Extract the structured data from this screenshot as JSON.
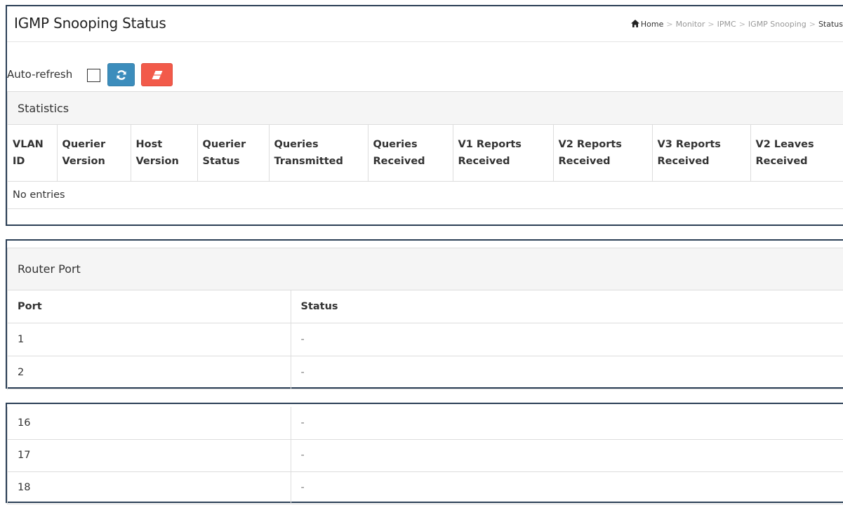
{
  "header": {
    "title": "IGMP Snooping Status",
    "breadcrumb": {
      "home": "Home",
      "items": [
        "Monitor",
        "IPMC",
        "IGMP Snooping"
      ],
      "current": "Status",
      "separator": ">"
    }
  },
  "toolbar": {
    "auto_refresh_label": "Auto-refresh",
    "auto_refresh_checked": false,
    "refresh_icon": "refresh-icon",
    "clear_icon": "eraser-icon",
    "refresh_color": "#3c8dbc",
    "clear_color": "#f25a4a"
  },
  "statistics": {
    "heading": "Statistics",
    "columns": [
      [
        "VLAN",
        "ID"
      ],
      [
        "Querier",
        "Version"
      ],
      [
        "Host",
        "Version"
      ],
      [
        "Querier",
        "Status"
      ],
      [
        "Queries",
        "Transmitted"
      ],
      [
        "Queries",
        "Received"
      ],
      [
        "V1 Reports",
        "Received"
      ],
      [
        "V2 Reports",
        "Received"
      ],
      [
        "V3 Reports",
        "Received"
      ],
      [
        "V2 Leaves",
        "Received"
      ]
    ],
    "empty_text": "No entries"
  },
  "router_port": {
    "heading": "Router Port",
    "col_port": "Port",
    "col_status": "Status",
    "rows": [
      {
        "port": "1",
        "status": "-"
      },
      {
        "port": "2",
        "status": "-"
      }
    ]
  },
  "router_port_continued": {
    "rows": [
      {
        "port": "16",
        "status": "-"
      },
      {
        "port": "17",
        "status": "-"
      },
      {
        "port": "18",
        "status": "-"
      }
    ]
  }
}
